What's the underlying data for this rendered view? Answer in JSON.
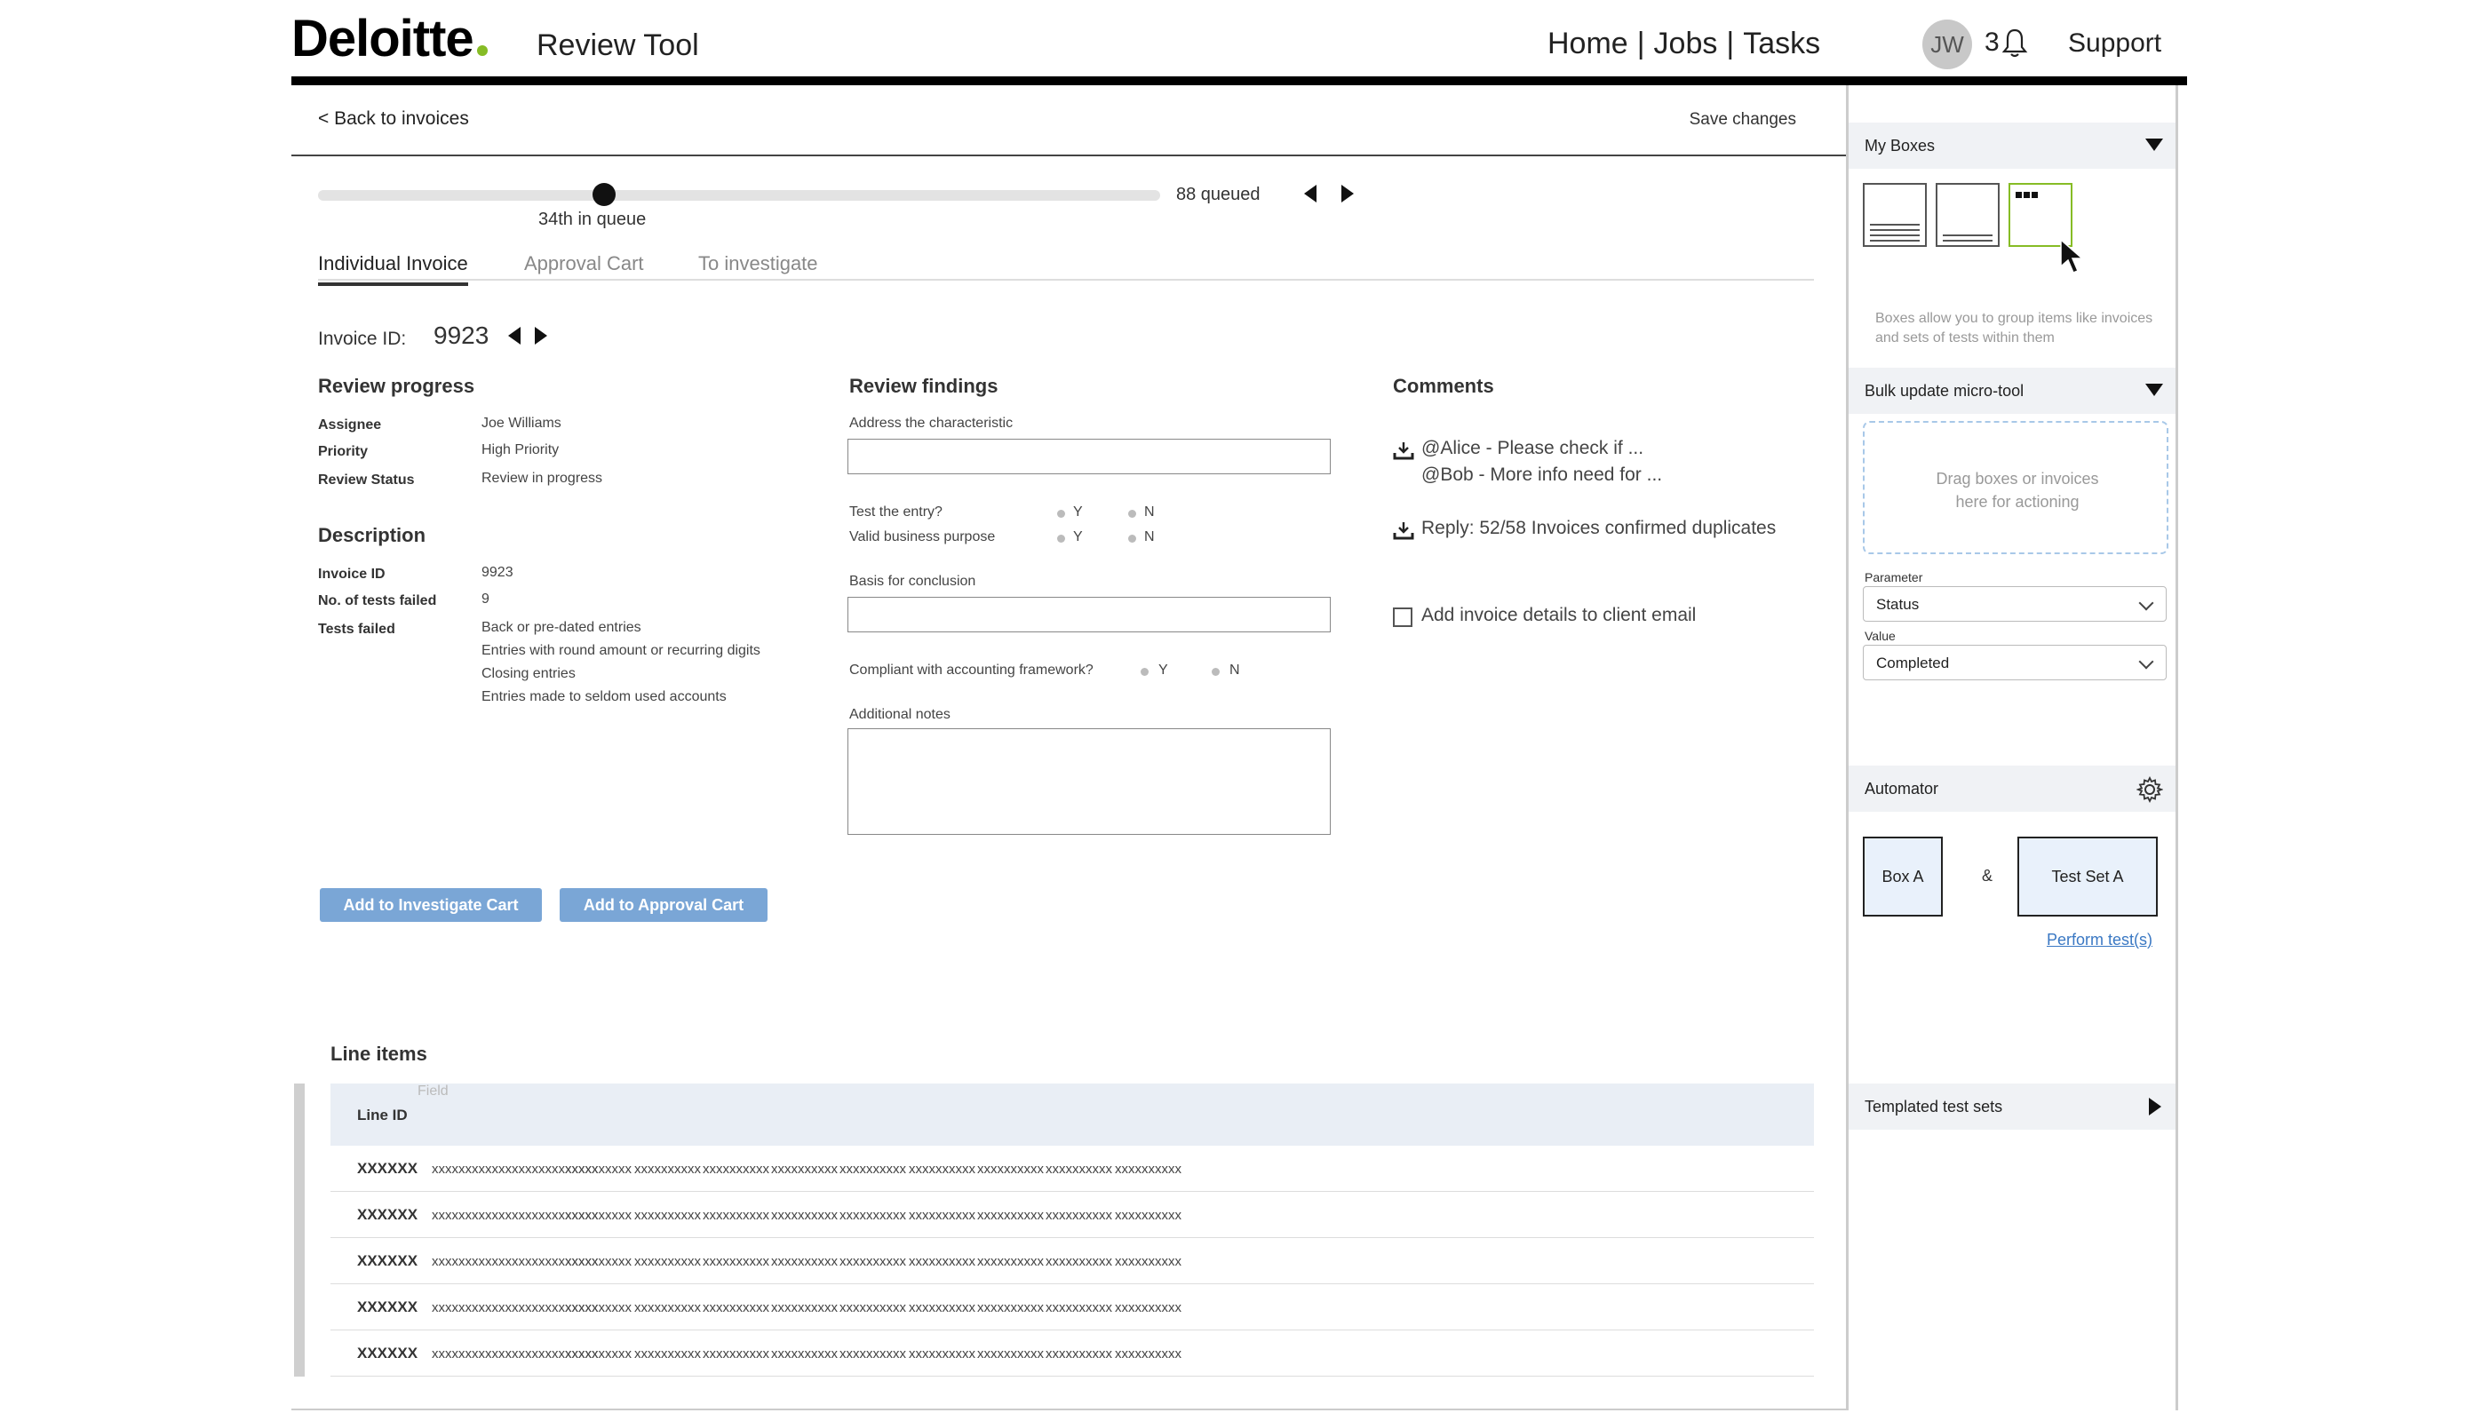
{
  "header": {
    "logo": "Deloitte",
    "app_title": "Review Tool",
    "nav": [
      "Home",
      "Jobs",
      "Tasks"
    ],
    "nav_sep": "|",
    "avatar": "JW",
    "notifications": "3",
    "support": "Support"
  },
  "main": {
    "back_link": "< Back to invoices",
    "save_link": "Save changes",
    "queue_position": "34th in queue",
    "queued": "88 queued",
    "queue_progress": 0.34,
    "tabs": [
      "Individual Invoice",
      "Approval Cart",
      "To investigate"
    ],
    "invoice_id_label": "Invoice ID:",
    "invoice_id": "9923"
  },
  "progress": {
    "title": "Review progress",
    "rows": [
      {
        "k": "Assignee",
        "v": "Joe Williams"
      },
      {
        "k": "Priority",
        "v": "High Priority"
      },
      {
        "k": "Review Status",
        "v": "Review in progress"
      }
    ]
  },
  "description": {
    "title": "Description",
    "rows": [
      {
        "k": "Invoice ID",
        "v": "9923"
      },
      {
        "k": "No. of tests failed",
        "v": "9"
      }
    ],
    "tests_failed_label": "Tests failed",
    "tests_failed": [
      "Back or pre-dated entries",
      "Entries with round amount or recurring digits",
      "Closing entries",
      "Entries made to seldom used accounts"
    ]
  },
  "findings": {
    "title": "Review findings",
    "address_label": "Address the characteristic",
    "test_entry": "Test the entry?",
    "valid_purpose": "Valid business purpose",
    "yes": "Y",
    "no": "N",
    "basis_label": "Basis for conclusion",
    "compliant": "Compliant with accounting framework?",
    "notes_label": "Additional notes"
  },
  "comments": {
    "title": "Comments",
    "thread": [
      "@Alice - Please check if ...",
      "@Bob - More info need for ..."
    ],
    "reply": "Reply: 52/58 Invoices confirmed duplicates",
    "add_details": "Add invoice details to client email"
  },
  "buttons": {
    "investigate": "Add to Investigate Cart",
    "approval": "Add to Approval Cart"
  },
  "line_items": {
    "title": "Line items",
    "field_hint": "Field",
    "col_id": "Line ID",
    "rows": [
      [
        "XXXXXX",
        "xxxxxxxxxxxxxxxxxxxxxxxxx",
        "xxxxxxxxxx",
        "xxxxxxxxxx",
        "xxxxxxxxxx",
        "xxxxxxxxxx",
        "xxxxxxxxxx",
        "xxxxxxxxxx",
        "xxxxxxxxxx",
        "xxxxxxxxxx",
        "xxxxxxxxxx"
      ],
      [
        "XXXXXX",
        "xxxxxxxxxxxxxxxxxxxxxxxxx",
        "xxxxxxxxxx",
        "xxxxxxxxxx",
        "xxxxxxxxxx",
        "xxxxxxxxxx",
        "xxxxxxxxxx",
        "xxxxxxxxxx",
        "xxxxxxxxxx",
        "xxxxxxxxxx",
        "xxxxxxxxxx"
      ],
      [
        "XXXXXX",
        "xxxxxxxxxxxxxxxxxxxxxxxxx",
        "xxxxxxxxxx",
        "xxxxxxxxxx",
        "xxxxxxxxxx",
        "xxxxxxxxxx",
        "xxxxxxxxxx",
        "xxxxxxxxxx",
        "xxxxxxxxxx",
        "xxxxxxxxxx",
        "xxxxxxxxxx"
      ],
      [
        "XXXXXX",
        "xxxxxxxxxxxxxxxxxxxxxxxxx",
        "xxxxxxxxxx",
        "xxxxxxxxxx",
        "xxxxxxxxxx",
        "xxxxxxxxxx",
        "xxxxxxxxxx",
        "xxxxxxxxxx",
        "xxxxxxxxxx",
        "xxxxxxxxxx",
        "xxxxxxxxxx"
      ],
      [
        "XXXXXX",
        "xxxxxxxxxxxxxxxxxxxxxxxxx",
        "xxxxxxxxxx",
        "xxxxxxxxxx",
        "xxxxxxxxxx",
        "xxxxxxxxxx",
        "xxxxxxxxxx",
        "xxxxxxxxxx",
        "xxxxxxxxxx",
        "xxxxxxxxxx",
        "xxxxxxxxxx"
      ]
    ]
  },
  "right_panel": {
    "my_boxes": "My Boxes",
    "boxes_note": "Boxes allow you to group items like invoices and sets of tests within them",
    "bulk_update": "Bulk update micro-tool",
    "dropzone_text": [
      "Drag boxes or invoices",
      "here for actioning"
    ],
    "parameter_label": "Parameter",
    "parameter_value": "Status",
    "value_label": "Value",
    "value_value": "Completed",
    "automator": "Automator",
    "box_a": "Box A",
    "amp": "&",
    "test_set_a": "Test Set A",
    "perform": "Perform test(s)",
    "templated": "Templated test sets"
  },
  "colors": {
    "accent_green": "#86bc25",
    "button_blue": "#7aa6d6",
    "link_blue": "#3a78c3"
  },
  "icons": [
    "bell-icon",
    "prev-arrow-icon",
    "next-arrow-icon",
    "download-icon",
    "gear-icon",
    "cursor-icon",
    "chevron-down-icon"
  ]
}
